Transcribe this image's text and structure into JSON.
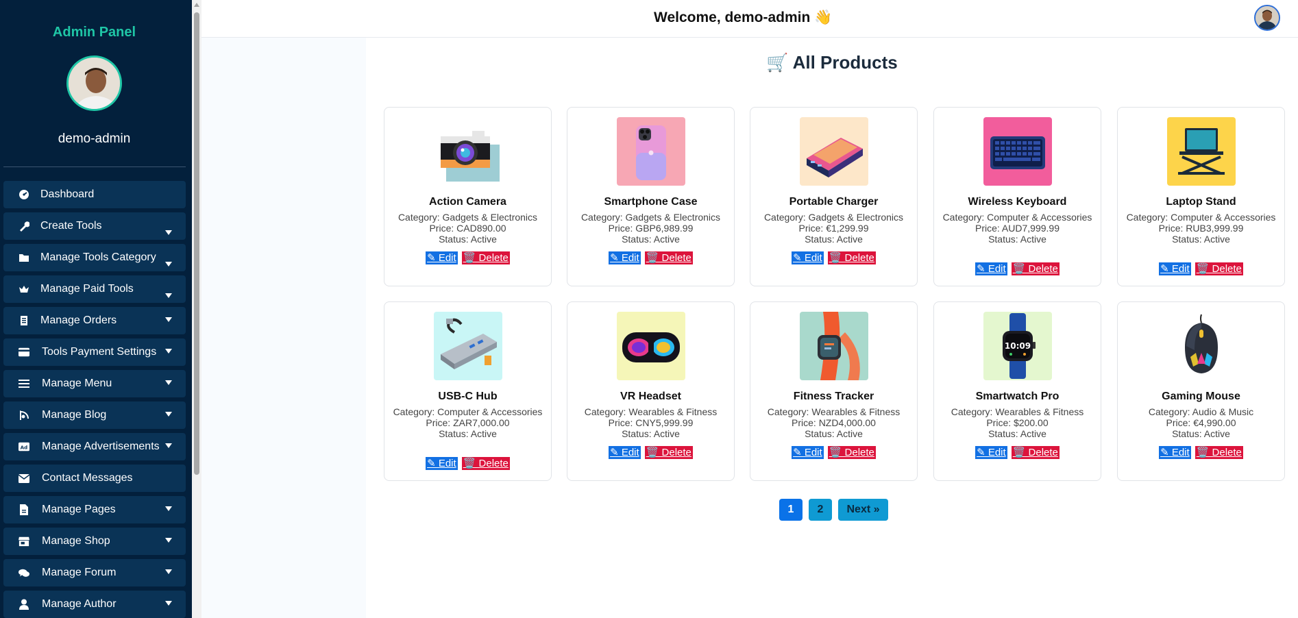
{
  "sidebar": {
    "title": "Admin Panel",
    "username": "demo-admin",
    "items": [
      {
        "label": "Dashboard",
        "icon": "dashboard-icon",
        "caret": "none"
      },
      {
        "label": "Create Tools",
        "icon": "wrench-icon",
        "caret": "low"
      },
      {
        "label": "Manage Tools Category",
        "icon": "folder-icon",
        "caret": "low"
      },
      {
        "label": "Manage Paid Tools",
        "icon": "crown-icon",
        "caret": "low"
      },
      {
        "label": "Manage Orders",
        "icon": "receipt-icon",
        "caret": "mid"
      },
      {
        "label": "Tools Payment Settings",
        "icon": "credit-card-icon",
        "caret": "mid"
      },
      {
        "label": "Manage Menu",
        "icon": "menu-icon",
        "caret": "mid"
      },
      {
        "label": "Manage Blog",
        "icon": "blog-icon",
        "caret": "mid"
      },
      {
        "label": "Manage Advertisements",
        "icon": "ad-icon",
        "caret": "mid"
      },
      {
        "label": "Contact Messages",
        "icon": "envelope-icon",
        "caret": "none"
      },
      {
        "label": "Manage Pages",
        "icon": "file-icon",
        "caret": "mid"
      },
      {
        "label": "Manage Shop",
        "icon": "store-icon",
        "caret": "mid"
      },
      {
        "label": "Manage Forum",
        "icon": "comments-icon",
        "caret": "mid"
      },
      {
        "label": "Manage Author",
        "icon": "user-icon",
        "caret": "mid"
      }
    ]
  },
  "header": {
    "welcome": "Welcome, demo-admin 👋"
  },
  "main": {
    "title": "All Products",
    "title_icon": "🛒",
    "edit_label": "✎ Edit",
    "delete_label": "🗑️ Delete",
    "products": [
      {
        "name": "Action Camera",
        "category": "Category: Gadgets & Electronics",
        "price": "Price: CAD890.00",
        "status": "Status: Active",
        "image": "camera-image",
        "bg": "#ffffff"
      },
      {
        "name": "Smartphone Case",
        "category": "Category: Gadgets & Electronics",
        "price": "Price: GBP6,989.99",
        "status": "Status: Active",
        "image": "phone-case-image",
        "bg": "#f7a7b4"
      },
      {
        "name": "Portable Charger",
        "category": "Category: Gadgets & Electronics",
        "price": "Price: €1,299.99",
        "status": "Status: Active",
        "image": "power-bank-image",
        "bg": "#fde7c9"
      },
      {
        "name": "Wireless Keyboard",
        "category": "Category: Computer & Accessories",
        "price": "Price: AUD7,999.99",
        "status": "Status: Active",
        "image": "keyboard-image",
        "bg": "#f25d9c"
      },
      {
        "name": "Laptop Stand",
        "category": "Category: Computer & Accessories",
        "price": "Price: RUB3,999.99",
        "status": "Status: Active",
        "image": "laptop-stand-image",
        "bg": "#fdd44a"
      },
      {
        "name": "USB-C Hub",
        "category": "Category: Computer & Accessories",
        "price": "Price: ZAR7,000.00",
        "status": "Status: Active",
        "image": "usb-hub-image",
        "bg": "#c9f6f6"
      },
      {
        "name": "VR Headset",
        "category": "Category: Wearables & Fitness",
        "price": "Price: CNY5,999.99",
        "status": "Status: Active",
        "image": "vr-headset-image",
        "bg": "#f5f6b8"
      },
      {
        "name": "Fitness Tracker",
        "category": "Category: Wearables & Fitness",
        "price": "Price: NZD4,000.00",
        "status": "Status: Active",
        "image": "fitness-tracker-image",
        "bg": "#a9d9cc"
      },
      {
        "name": "Smartwatch Pro",
        "category": "Category: Wearables & Fitness",
        "price": "Price: $200.00",
        "status": "Status: Active",
        "image": "smartwatch-image",
        "bg": "#e4f7cf"
      },
      {
        "name": "Gaming Mouse",
        "category": "Category: Audio & Music",
        "price": "Price: €4,990.00",
        "status": "Status: Active",
        "image": "gaming-mouse-image",
        "bg": "#ffffff"
      }
    ]
  },
  "pagination": {
    "page1": "1",
    "page2": "2",
    "next": "Next »"
  },
  "watch_time": "10:09"
}
